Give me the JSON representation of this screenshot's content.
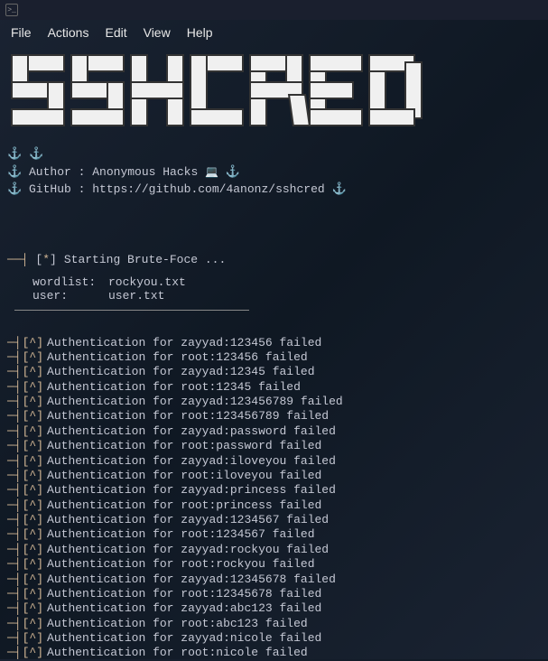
{
  "menubar": {
    "file": "File",
    "actions": "Actions",
    "edit": "Edit",
    "view": "View",
    "help": "Help"
  },
  "banner": {
    "line1": " ______   ______   __  __   ______   ______   ______   _____   ",
    "line2": "/\\  ___\\ /\\  ___\\ /\\ \\_\\ \\ /\\  ___\\ /\\  == \\ /\\  ___\\ /\\  __-. ",
    "line3": "\\ \\___  \\\\ \\___  \\\\ \\  __ \\\\ \\ \\____\\ \\  __< \\ \\  __\\ \\ \\ \\/\\ \\",
    "line4": " \\/\\_____\\\\/\\_____\\\\ \\_\\ \\_\\\\ \\_____\\\\ \\_\\ \\_\\\\ \\_____\\\\ \\____-",
    "line5": "  \\/_____/ \\/_____/ \\/_/\\/_/ \\/_____/ \\/_/ /_/ \\/_____/ \\/____/"
  },
  "info": {
    "author_label": "Author :",
    "author_value": "Anonymous Hacks",
    "github_label": "GitHub :",
    "github_value": "https://github.com/4anonz/sshcred"
  },
  "starting": {
    "prefix": "──┤",
    "bracket_open": "[",
    "star": "*",
    "bracket_close": "]",
    "text": "Starting Brute-Foce ..."
  },
  "config": {
    "wordlist_label": "wordlist:",
    "wordlist_value": "rockyou.txt",
    "user_label": "user:",
    "user_value": "user.txt"
  },
  "attempt_prefix": {
    "dash": "─┤",
    "bracket_open": "[",
    "caret": "^",
    "bracket_close": "]"
  },
  "attempts": [
    "Authentication for zayyad:123456 failed",
    "Authentication for root:123456 failed",
    "Authentication for zayyad:12345 failed",
    "Authentication for root:12345 failed",
    "Authentication for zayyad:123456789 failed",
    "Authentication for root:123456789 failed",
    "Authentication for zayyad:password failed",
    "Authentication for root:password failed",
    "Authentication for zayyad:iloveyou failed",
    "Authentication for root:iloveyou failed",
    "Authentication for zayyad:princess failed",
    "Authentication for root:princess failed",
    "Authentication for zayyad:1234567 failed",
    "Authentication for root:1234567 failed",
    "Authentication for zayyad:rockyou failed",
    "Authentication for root:rockyou failed",
    "Authentication for zayyad:12345678 failed",
    "Authentication for root:12345678 failed",
    "Authentication for zayyad:abc123 failed",
    "Authentication for root:abc123 failed",
    "Authentication for zayyad:nicole failed",
    "Authentication for root:nicole failed"
  ]
}
